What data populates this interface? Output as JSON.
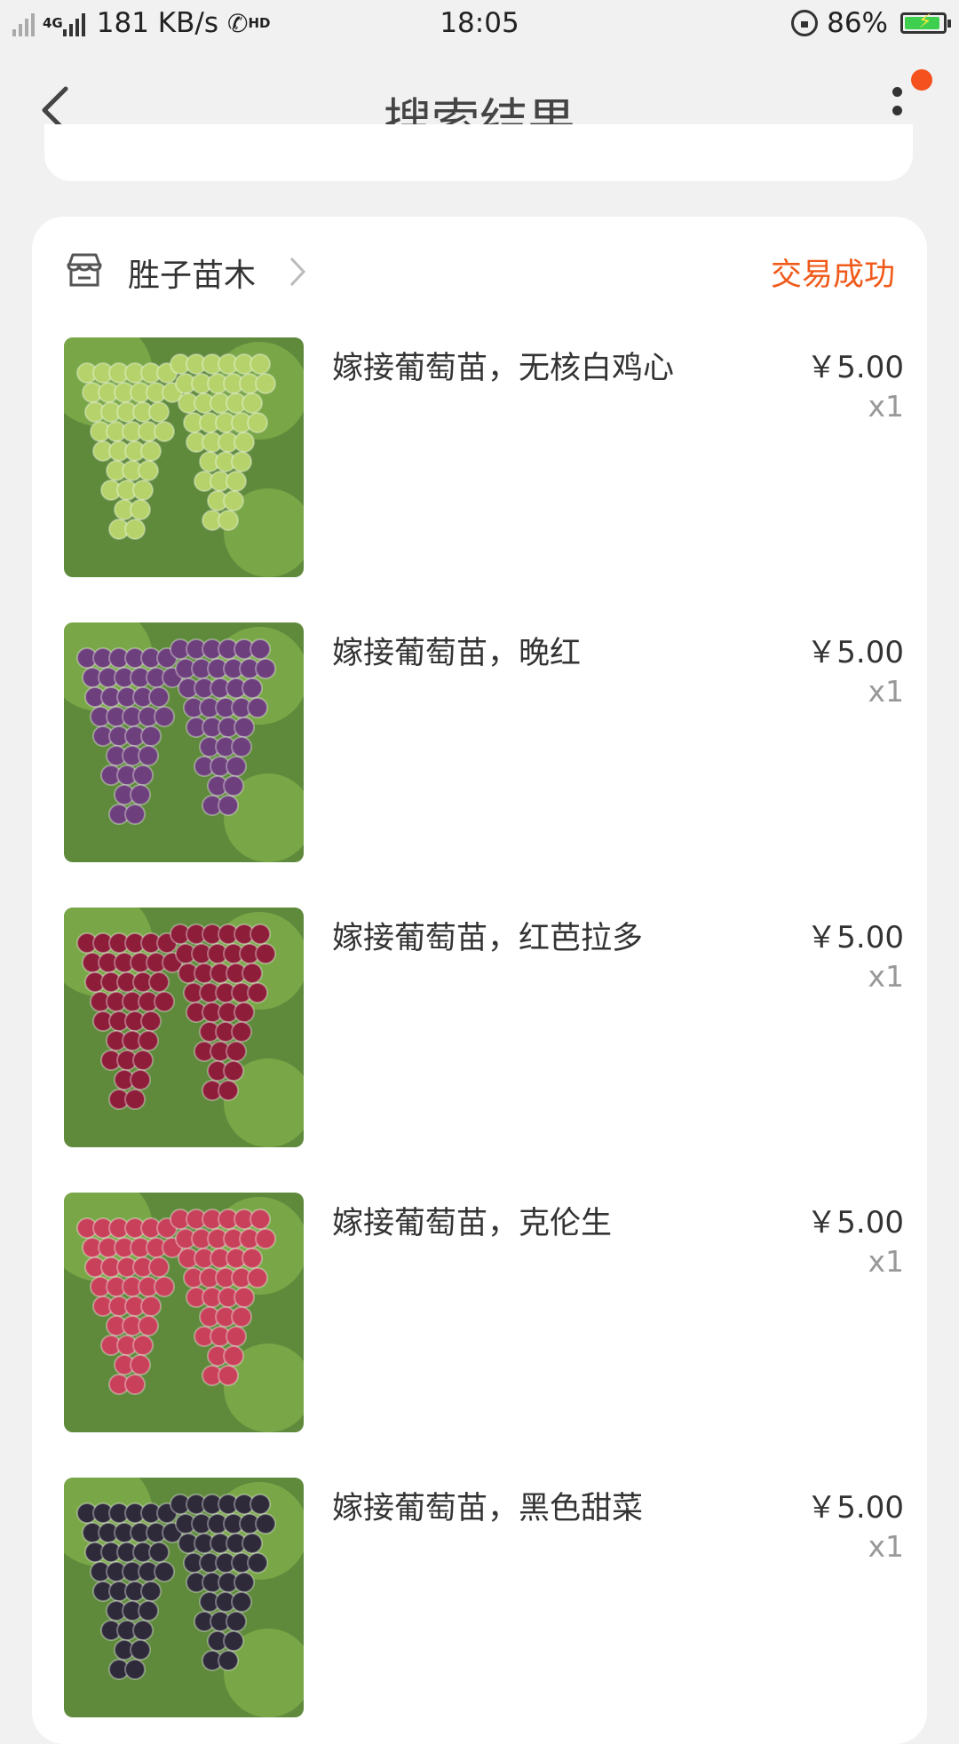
{
  "status_bar": {
    "speed": "181 KB/s",
    "net_tag": "4G",
    "hd_tag": "HD",
    "time": "18:05",
    "battery": "86%"
  },
  "header": {
    "title": "搜索结果"
  },
  "order": {
    "shop_name": "胜子苗木",
    "status": "交易成功",
    "status_color": "#f05a1a",
    "items": [
      {
        "title": "嫁接葡萄苗，无核白鸡心",
        "price": "￥5.00",
        "qty": "x1",
        "grape_color": "#b5d36a"
      },
      {
        "title": "嫁接葡萄苗，晚红",
        "price": "￥5.00",
        "qty": "x1",
        "grape_color": "#6d3f7c"
      },
      {
        "title": "嫁接葡萄苗，红芭拉多",
        "price": "￥5.00",
        "qty": "x1",
        "grape_color": "#8e1d3a"
      },
      {
        "title": "嫁接葡萄苗，克伦生",
        "price": "￥5.00",
        "qty": "x1",
        "grape_color": "#c9405a"
      },
      {
        "title": "嫁接葡萄苗，黑色甜菜",
        "price": "￥5.00",
        "qty": "x1",
        "grape_color": "#2e2a3a"
      }
    ]
  }
}
